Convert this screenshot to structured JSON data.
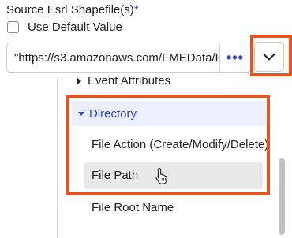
{
  "field": {
    "label": "Source Esri Shapefile(s)",
    "required_marker": "*"
  },
  "use_default": {
    "label": "Use Default Value",
    "checked": false
  },
  "source_input": {
    "value": "\"https://s3.amazonaws.com/FMEData/F",
    "more_button": "•••"
  },
  "attribute_menu": {
    "items": [
      {
        "label": "Event Attributes",
        "expanded": false
      },
      {
        "label": "Directory",
        "expanded": true,
        "children": [
          {
            "label": "File Action (Create/Modify/Delete)"
          },
          {
            "label": "File Path",
            "hovered": true
          },
          {
            "label": "File Root Name"
          }
        ]
      }
    ]
  },
  "colors": {
    "accent": "#2f47c7",
    "highlight": "#e8531f",
    "selected_bg": "#eceffd",
    "hover_bg": "#e9e9e9"
  }
}
